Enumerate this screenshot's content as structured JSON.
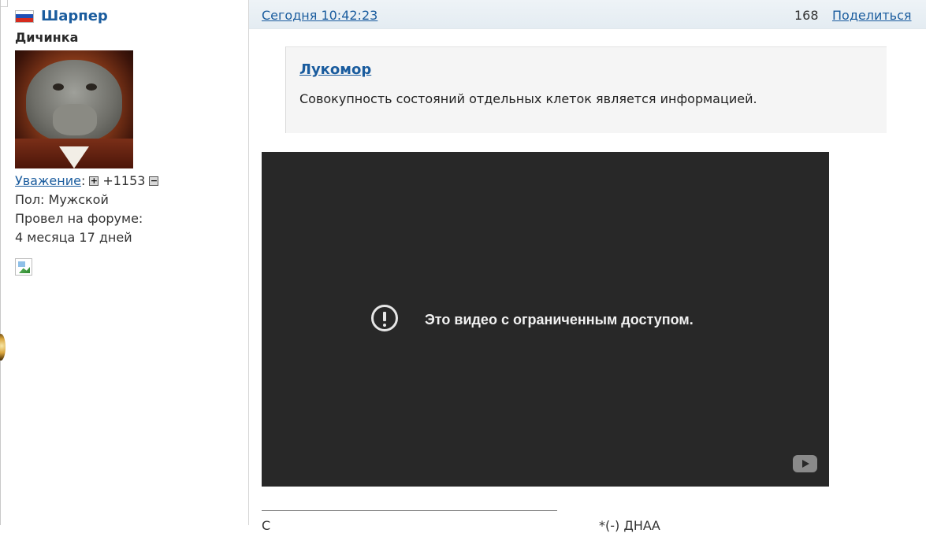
{
  "user": {
    "name": "Шарпер",
    "title": "Дичинка",
    "reputation_label": "Уважение",
    "reputation_value": "+1153",
    "gender": "Пол: Мужской",
    "forum_time_label": "Провел на форуме:",
    "forum_time_value": "4 месяца 17 дней",
    "flag": "russia-flag-icon"
  },
  "post": {
    "date": "Сегодня 10:42:23",
    "number": "168",
    "share_label": "Поделиться"
  },
  "quote": {
    "author": "Лукомор",
    "text": "Совокупность состояний отдельных клеток является информацией."
  },
  "video": {
    "message": "Это видео с ограниченным доступом."
  },
  "signature": {
    "text_start": "С",
    "text_end": "*(-) ДНАА"
  },
  "colors": {
    "link": "#1a5c9e",
    "video_bg": "#282828",
    "header_bg": "#e4ecf2"
  }
}
